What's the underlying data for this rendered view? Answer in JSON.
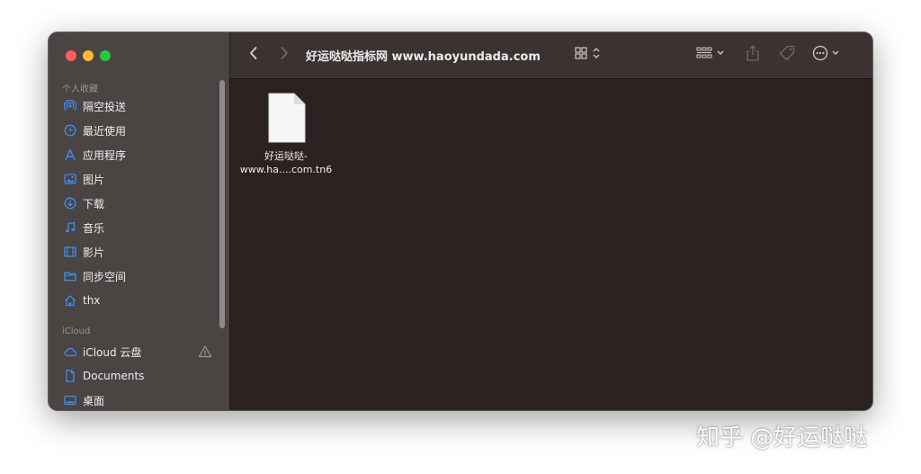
{
  "window": {
    "title": "好运哒哒指标网 www.haoyundada.com"
  },
  "sidebar": {
    "favorites_header": "个人收藏",
    "favorites": [
      {
        "label": "隔空投送",
        "icon": "airdrop-icon"
      },
      {
        "label": "最近使用",
        "icon": "clock-icon"
      },
      {
        "label": "应用程序",
        "icon": "applications-icon"
      },
      {
        "label": "图片",
        "icon": "photo-icon"
      },
      {
        "label": "下载",
        "icon": "download-icon"
      },
      {
        "label": "音乐",
        "icon": "music-icon"
      },
      {
        "label": "影片",
        "icon": "movie-icon"
      },
      {
        "label": "同步空间",
        "icon": "folder-icon"
      },
      {
        "label": "thx",
        "icon": "home-icon"
      }
    ],
    "icloud_header": "iCloud",
    "icloud": [
      {
        "label": "iCloud 云盘",
        "icon": "cloud-icon",
        "warning_icon": "warning-icon"
      },
      {
        "label": "Documents",
        "icon": "document-icon"
      },
      {
        "label": "桌面",
        "icon": "desktop-icon"
      }
    ]
  },
  "toolbar": {
    "back_icon": "chevron-left-icon",
    "forward_icon": "chevron-right-icon",
    "view_icon": "icon-grid-view-icon",
    "group_icon": "group-by-icon",
    "share_icon": "share-icon",
    "tag_icon": "tag-icon",
    "more_icon": "ellipsis-circle-icon",
    "search_icon": "search-icon"
  },
  "files": [
    {
      "name_line1": "好运哒哒-",
      "name_line2": "www.ha....com.tn6",
      "icon": "document-icon"
    }
  ],
  "watermark": "知乎 @好运哒哒",
  "colors": {
    "accent": "#3d8ff5",
    "sidebar_bg": "#4a4443",
    "content_bg": "#2c2221",
    "toolbar_bg": "#3a3332"
  }
}
